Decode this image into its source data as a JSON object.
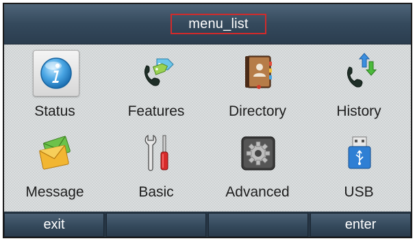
{
  "title": "menu_list",
  "menu": {
    "items": [
      {
        "label": "Status",
        "icon": "info-icon"
      },
      {
        "label": "Features",
        "icon": "phone-tag-icon"
      },
      {
        "label": "Directory",
        "icon": "address-book-icon"
      },
      {
        "label": "History",
        "icon": "phone-arrows-icon"
      },
      {
        "label": "Message",
        "icon": "envelopes-icon"
      },
      {
        "label": "Basic",
        "icon": "wrench-screwdriver-icon"
      },
      {
        "label": "Advanced",
        "icon": "gear-icon"
      },
      {
        "label": "USB",
        "icon": "usb-drive-icon"
      }
    ],
    "selected_index": 0
  },
  "softkeys": [
    "exit",
    "",
    "",
    "enter"
  ],
  "colors": {
    "title_bar": "#34495c",
    "title_highlight_border": "#d42a2a",
    "grid_background": "#cfd3d4",
    "softkey": "#34495c"
  }
}
